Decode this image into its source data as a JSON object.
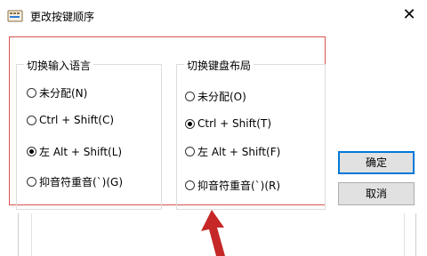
{
  "window": {
    "title": "更改按键顺序",
    "close_glyph": "✕"
  },
  "input_language_group": {
    "legend": "切换输入语言",
    "options": [
      {
        "label": "未分配(N)",
        "selected": false
      },
      {
        "label": "Ctrl + Shift(C)",
        "selected": false
      },
      {
        "label": "左 Alt + Shift(L)",
        "selected": true
      },
      {
        "label": "抑音符重音(`)(G)",
        "selected": false
      }
    ]
  },
  "keyboard_layout_group": {
    "legend": "切换键盘布局",
    "options": [
      {
        "label": "未分配(O)",
        "selected": false
      },
      {
        "label": "Ctrl + Shift(T)",
        "selected": true
      },
      {
        "label": "左 Alt + Shift(F)",
        "selected": false
      },
      {
        "label": "抑音符重音(`)(R)",
        "selected": false
      }
    ]
  },
  "buttons": {
    "ok": "确定",
    "cancel": "取消"
  },
  "colors": {
    "highlight_box": "#d9534f",
    "arrow": "#c62828",
    "default_button_border": "#0078d7"
  },
  "icons": {
    "title": "keyboard-icon",
    "close": "close-icon",
    "arrow": "red-arrow-icon"
  }
}
